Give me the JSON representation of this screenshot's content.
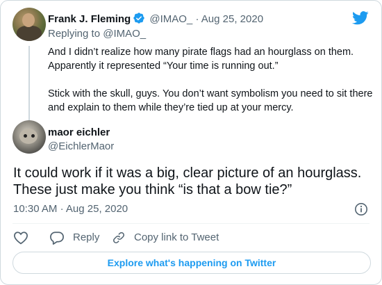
{
  "parent_tweet": {
    "author_name": "Frank J. Fleming",
    "author_handle": "@IMAO_",
    "separator": "·",
    "date": "Aug 25, 2020",
    "replying_to_label": "Replying to",
    "replying_to_handle": "@IMAO_",
    "paragraph_1": "And I didn’t realize how many pirate flags had an hourglass on them. Apparently it represented “Your time is running out.”",
    "paragraph_2": "Stick with the skull, guys. You don’t want symbolism you need to sit there and explain to them while they’re tied up at your mercy."
  },
  "tweet": {
    "author_name": "maor eichler",
    "author_handle": "@EichlerMaor",
    "text": "It could work if it was a big, clear picture of an hourglass. These just make you think “is that a bow tie?”",
    "time": "10:30 AM",
    "separator": "·",
    "date": "Aug 25, 2020"
  },
  "actions": {
    "reply_label": "Reply",
    "copy_link_label": "Copy link to Tweet"
  },
  "explore_label": "Explore what's happening on Twitter",
  "icons": {
    "brand": "twitter-bird-icon",
    "verified": "verified-badge-icon",
    "like": "heart-icon",
    "reply": "reply-bubble-icon",
    "copy": "link-icon",
    "info": "info-icon"
  },
  "colors": {
    "accent": "#1d9bf0",
    "secondary_text": "#536471",
    "border": "#cfd9de"
  }
}
